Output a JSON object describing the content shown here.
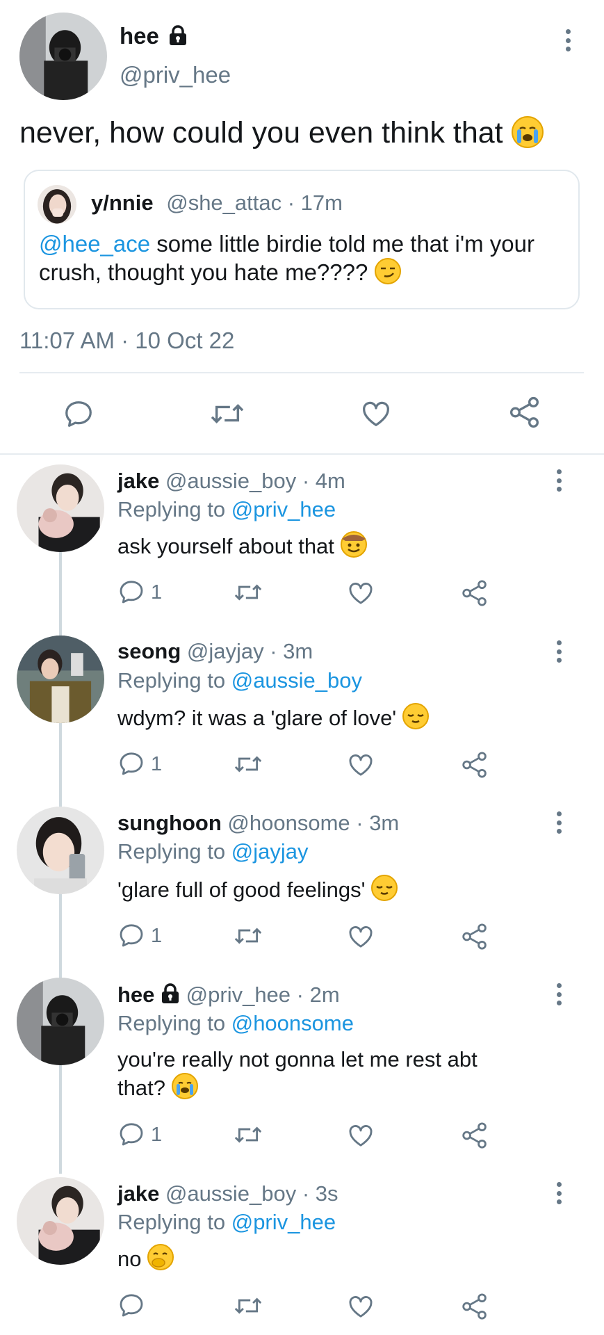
{
  "main_tweet": {
    "name": "hee",
    "handle": "@priv_hee",
    "text": "never, how could you even think that",
    "timestamp": "11:07 AM · 10 Oct 22",
    "quoted": {
      "name": "y/nnie",
      "handle_time": "@she_attac · 17m",
      "mention": "@hee_ace",
      "text": " some little birdie told me that i'm your crush, thought you hate me????"
    }
  },
  "replies": [
    {
      "name": "jake",
      "meta": " @aussie_boy · 4m",
      "replying_prefix": "Replying to ",
      "replying_handle": "@priv_hee",
      "text": "ask yourself about that",
      "reply_count": "1"
    },
    {
      "name": "seong",
      "meta": " @jayjay · 3m",
      "replying_prefix": "Replying to ",
      "replying_handle": "@aussie_boy",
      "text": "wdym? it was a 'glare of love'",
      "reply_count": "1"
    },
    {
      "name": "sunghoon",
      "meta": " @hoonsome · 3m",
      "replying_prefix": "Replying to ",
      "replying_handle": "@jayjay",
      "text": "'glare full of good feelings'",
      "reply_count": "1"
    },
    {
      "name": "hee",
      "meta": " @priv_hee · 2m",
      "replying_prefix": "Replying to ",
      "replying_handle": "@hoonsome",
      "text_line1": "you're really not gonna let me rest abt",
      "text_line2": "that?",
      "reply_count": "1"
    },
    {
      "name": "jake",
      "meta": " @aussie_boy · 3s",
      "replying_prefix": "Replying to ",
      "replying_handle": "@priv_hee",
      "text": "no",
      "reply_count": ""
    }
  ],
  "colors": {
    "text": "#14171a",
    "muted": "#657786",
    "link": "#1b95e0",
    "divider": "#e6ecf0"
  },
  "icons": [
    "lock-icon",
    "more-options-icon",
    "reply-icon",
    "retweet-icon",
    "like-icon",
    "share-icon",
    "crying-emoji",
    "smirk-emoji",
    "cowboy-emoji",
    "relieved-emoji",
    "hand-over-mouth-emoji"
  ]
}
